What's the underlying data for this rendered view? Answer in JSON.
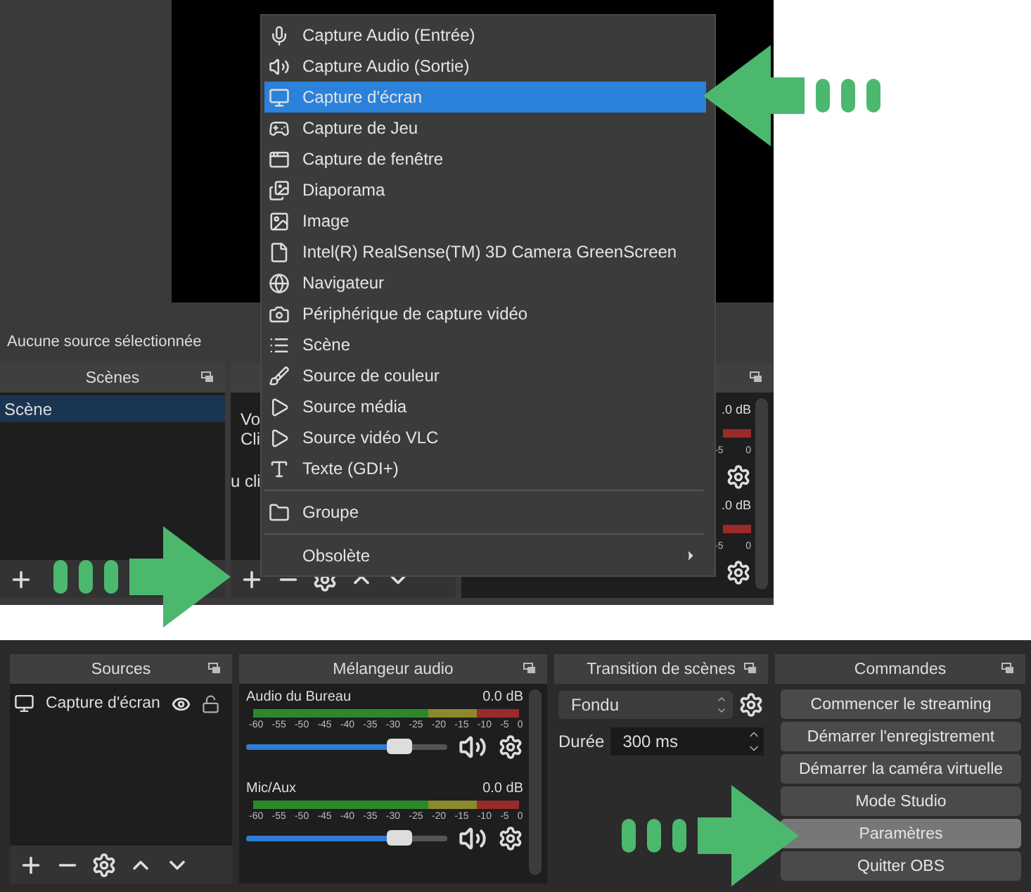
{
  "top_screenshot": {
    "status_text": "Aucune source sélectionnée",
    "scenes_dock": {
      "title": "Scènes",
      "items": [
        {
          "label": "Scène",
          "selected": true
        }
      ]
    },
    "sources_dock": {
      "fragments": [
        "Vo",
        "Cli",
        "u cli"
      ]
    },
    "mixer_dock": {
      "channels": [
        {
          "reading": ".0 dB",
          "ticks": [
            "-5",
            "0"
          ]
        },
        {
          "reading": ".0 dB",
          "ticks": [
            "-5",
            "0"
          ]
        }
      ]
    },
    "context_menu": {
      "items": [
        {
          "kind": "item",
          "label": "Capture Audio (Entrée)",
          "selected": false
        },
        {
          "kind": "item",
          "label": "Capture Audio (Sortie)",
          "selected": false
        },
        {
          "kind": "item",
          "label": "Capture d'écran",
          "selected": true
        },
        {
          "kind": "item",
          "label": "Capture de Jeu",
          "selected": false
        },
        {
          "kind": "item",
          "label": "Capture de fenêtre",
          "selected": false
        },
        {
          "kind": "item",
          "label": "Diaporama",
          "selected": false
        },
        {
          "kind": "item",
          "label": "Image",
          "selected": false
        },
        {
          "kind": "item",
          "label": "Intel(R) RealSense(TM) 3D Camera GreenScreen",
          "selected": false
        },
        {
          "kind": "item",
          "label": "Navigateur",
          "selected": false
        },
        {
          "kind": "item",
          "label": "Périphérique de capture vidéo",
          "selected": false
        },
        {
          "kind": "item",
          "label": "Scène",
          "selected": false
        },
        {
          "kind": "item",
          "label": "Source de couleur",
          "selected": false
        },
        {
          "kind": "item",
          "label": "Source média",
          "selected": false
        },
        {
          "kind": "item",
          "label": "Source vidéo VLC",
          "selected": false
        },
        {
          "kind": "item",
          "label": "Texte (GDI+)",
          "selected": false
        },
        {
          "kind": "separator"
        },
        {
          "kind": "item",
          "label": "Groupe",
          "selected": false
        },
        {
          "kind": "separator"
        },
        {
          "kind": "submenu",
          "label": "Obsolète",
          "selected": false
        }
      ]
    }
  },
  "bottom_screenshot": {
    "sources_dock": {
      "title": "Sources",
      "items": [
        {
          "label": "Capture d'écran",
          "visible": true,
          "locked": false
        }
      ]
    },
    "mixer_dock": {
      "title": "Mélangeur audio",
      "channels": [
        {
          "name": "Audio du Bureau",
          "reading": "0.0 dB",
          "level": 0.76,
          "ticks": [
            "-60",
            "-55",
            "-50",
            "-45",
            "-40",
            "-35",
            "-30",
            "-25",
            "-20",
            "-15",
            "-10",
            "-5",
            "0"
          ]
        },
        {
          "name": "Mic/Aux",
          "reading": "0.0 dB",
          "level": 0.76,
          "ticks": [
            "-60",
            "-55",
            "-50",
            "-45",
            "-40",
            "-35",
            "-30",
            "-25",
            "-20",
            "-15",
            "-10",
            "-5",
            "0"
          ]
        }
      ]
    },
    "transition_dock": {
      "title": "Transition de scènes",
      "transition": "Fondu",
      "duration_label": "Durée",
      "duration": "300 ms"
    },
    "controls_dock": {
      "title": "Commandes",
      "buttons": [
        {
          "label": "Commencer le streaming",
          "hovered": false
        },
        {
          "label": "Démarrer l'enregistrement",
          "hovered": false
        },
        {
          "label": "Démarrer la caméra virtuelle",
          "hovered": false
        },
        {
          "label": "Mode Studio",
          "hovered": false
        },
        {
          "label": "Paramètres",
          "hovered": true
        },
        {
          "label": "Quitter OBS",
          "hovered": false
        }
      ]
    }
  }
}
